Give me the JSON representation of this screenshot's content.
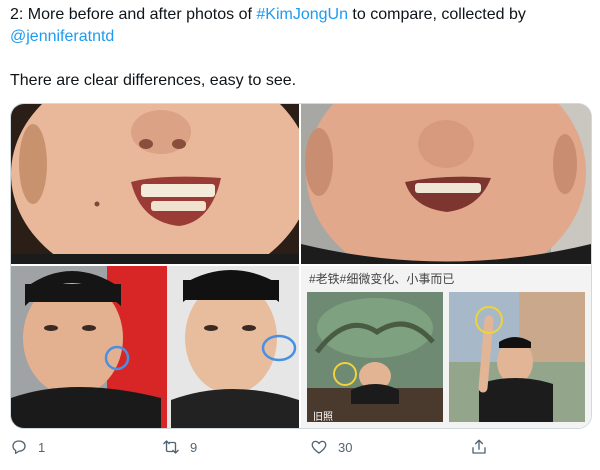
{
  "tweet": {
    "line1_prefix": "2: More before and after photos of ",
    "hashtag": "#KimJongUn",
    "line1_suffix": " to compare, collected by",
    "mention": "@jenniferatntd",
    "line2": "There are clear differences, easy to see."
  },
  "media": {
    "caption": "#老铁#细微变化、小事而已",
    "photo_tag": "旧照"
  },
  "actions": {
    "reply_count": "1",
    "retweet_count": "9",
    "like_count": "30"
  },
  "colors": {
    "link": "#1d9bf0",
    "action_icon": "#536471",
    "highlight_circle": "#4a90e2"
  }
}
